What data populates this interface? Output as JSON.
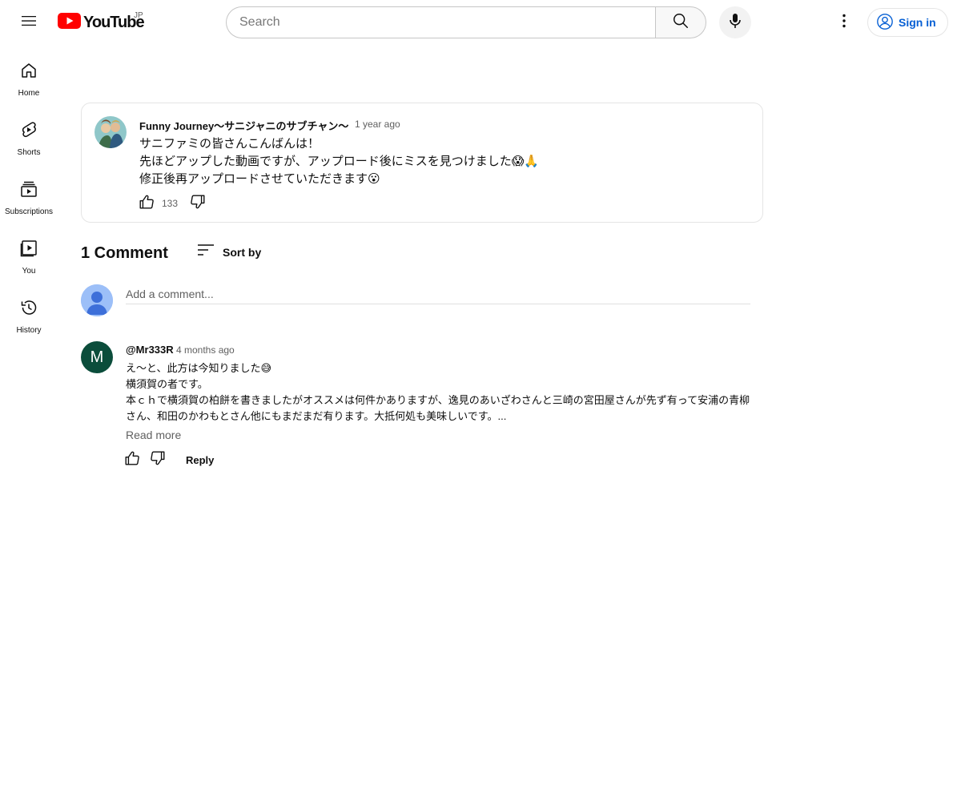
{
  "header": {
    "menu_icon": "hamburger-menu-icon",
    "logo_text": "YouTube",
    "region": "JP",
    "search_placeholder": "Search",
    "signin_label": "Sign in",
    "accent_color": "#ff0000",
    "link_color": "#065fd4"
  },
  "sidebar": {
    "items": [
      {
        "label": "Home",
        "icon": "home-icon"
      },
      {
        "label": "Shorts",
        "icon": "shorts-icon"
      },
      {
        "label": "Subscriptions",
        "icon": "subscriptions-icon"
      },
      {
        "label": "You",
        "icon": "you-icon"
      },
      {
        "label": "History",
        "icon": "history-icon"
      }
    ]
  },
  "post": {
    "author": "Funny Journey〜サニジャニのサブチャン〜",
    "time": "1 year ago",
    "lines": [
      "サニファミの皆さんこんばんは！",
      "先ほどアップした動画ですが、アップロード後にミスを見つけました😱🙏",
      "修正後再アップロードさせていただきます😮"
    ],
    "likes": "133"
  },
  "comments": {
    "title": "1 Comment",
    "sort_label": "Sort by",
    "add_placeholder": "Add a comment...",
    "items": [
      {
        "avatar_letter": "M",
        "author": "@Mr333R",
        "time": "4 months ago",
        "lines": [
          "え〜と、此方は今知りました😅",
          "横須賀の者です。",
          "本ｃｈで横須賀の柏餅を書きましたがオススメは何件かありますが、逸見のあいざわさんと三崎の宮田屋さんが先ず有って安浦の青柳さん、和田のかわもとさん他にもまだまだ有ります。大抵何処も美味しいです。..."
        ],
        "read_more": "Read more",
        "reply": "Reply"
      }
    ]
  }
}
